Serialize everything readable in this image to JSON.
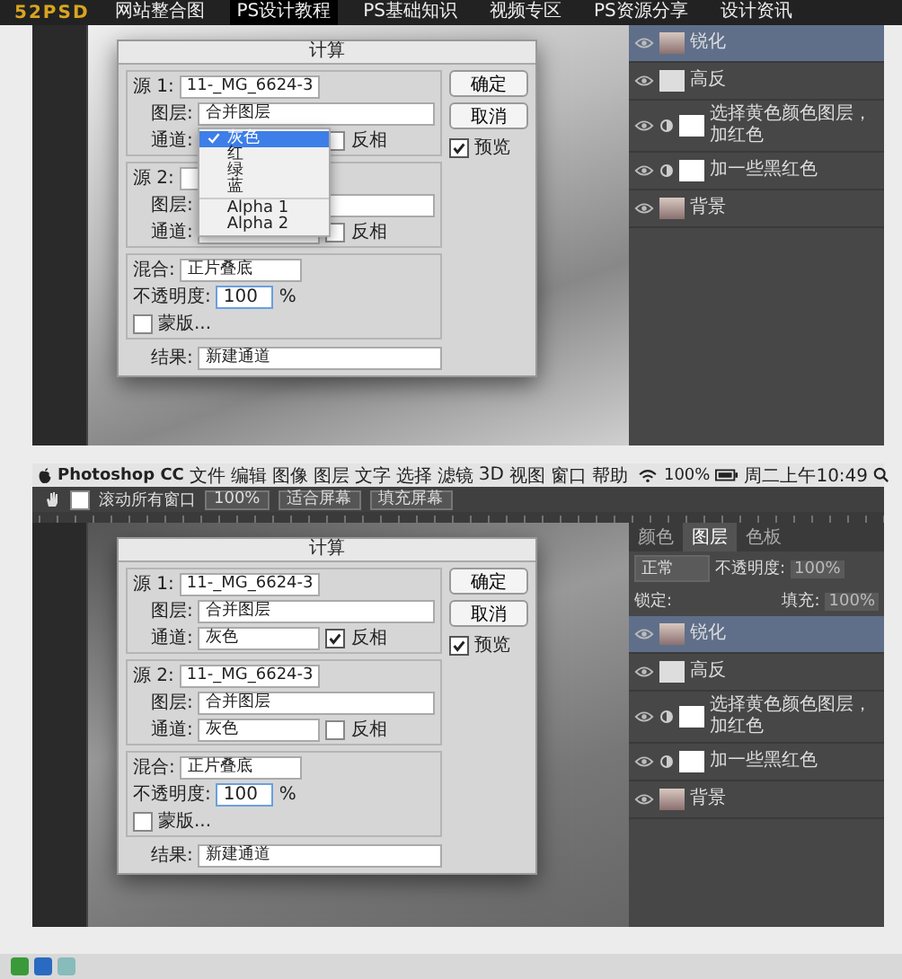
{
  "site_nav": {
    "logo": "52PSD",
    "items": [
      {
        "label": "网站整合图",
        "selected": false
      },
      {
        "label": "PS设计教程",
        "selected": true
      },
      {
        "label": "PS基础知识",
        "selected": false
      },
      {
        "label": "视频专区",
        "selected": false
      },
      {
        "label": "PS资源分享",
        "selected": false
      },
      {
        "label": "设计资讯",
        "selected": false
      }
    ]
  },
  "screenshot_1": {
    "dialog": {
      "title": "计算",
      "ok": "确定",
      "cancel": "取消",
      "preview": {
        "label": "预览",
        "checked": true
      },
      "source_1": {
        "label": "源 1:",
        "value": "11-_MG_6624-3",
        "layer_label": "图层:",
        "layer": "合并图层",
        "channel_label": "通道:",
        "invert_label": "反相",
        "invert": false
      },
      "source_2": {
        "label": "源 2:",
        "layer_label": "图层:",
        "channel_label": "通道:",
        "invert_label": "反相",
        "invert": false
      },
      "blend_label": "混合:",
      "blend": "正片叠底",
      "opacity_label": "不透明度:",
      "opacity": "100",
      "opacity_unit": "%",
      "mask": {
        "label": "蒙版...",
        "checked": false
      },
      "result_label": "结果:",
      "result": "新建通道",
      "channel_menu": [
        {
          "kind": "item",
          "label": "灰色",
          "selected": true
        },
        {
          "kind": "item",
          "label": "红",
          "selected": false
        },
        {
          "kind": "item",
          "label": "绿",
          "selected": false
        },
        {
          "kind": "item",
          "label": "蓝",
          "selected": false
        },
        {
          "kind": "separator"
        },
        {
          "kind": "item",
          "label": "Alpha 1",
          "selected": false
        },
        {
          "kind": "item",
          "label": "Alpha 2",
          "selected": false
        }
      ]
    },
    "layers": [
      {
        "name": "锐化",
        "kind": "image",
        "selected": true
      },
      {
        "name": "高反",
        "kind": "blank",
        "selected": false
      },
      {
        "name": "选择黄色颜色图层，加红色",
        "kind": "adjustment",
        "selected": false
      },
      {
        "name": "加一些黑红色",
        "kind": "adjustment",
        "selected": false
      },
      {
        "name": "背景",
        "kind": "image",
        "selected": false
      }
    ]
  },
  "screenshot_2": {
    "menu_bar": {
      "app": "Photoshop CC",
      "items": [
        "文件",
        "编辑",
        "图像",
        "图层",
        "文字",
        "选择",
        "滤镜",
        "3D",
        "视图",
        "窗口",
        "帮助"
      ],
      "battery": "100%",
      "clock": "周二上午10:49"
    },
    "options_bar": {
      "scroll_all": {
        "label": "滚动所有窗口",
        "checked": false
      },
      "buttons": [
        "100%",
        "适合屏幕",
        "填充屏幕"
      ]
    },
    "layers_panel": {
      "tabs": [
        {
          "label": "颜色",
          "selected": false
        },
        {
          "label": "图层",
          "selected": true
        },
        {
          "label": "色板",
          "selected": false
        }
      ],
      "blend_mode": "正常",
      "opacity_label": "不透明度:",
      "opacity": "100%",
      "lock_label": "锁定:",
      "fill_label": "填充:",
      "fill": "100%"
    },
    "layers": [
      {
        "name": "锐化",
        "kind": "image",
        "selected": true
      },
      {
        "name": "高反",
        "kind": "blank",
        "selected": false
      },
      {
        "name": "选择黄色颜色图层，加红色",
        "kind": "adjustment",
        "selected": false
      },
      {
        "name": "加一些黑红色",
        "kind": "adjustment",
        "selected": false
      },
      {
        "name": "背景",
        "kind": "image",
        "selected": false
      }
    ],
    "dialog": {
      "title": "计算",
      "ok": "确定",
      "cancel": "取消",
      "preview": {
        "label": "预览",
        "checked": true
      },
      "source_1": {
        "label": "源 1:",
        "value": "11-_MG_6624-3",
        "layer_label": "图层:",
        "layer": "合并图层",
        "channel_label": "通道:",
        "channel": "灰色",
        "invert_label": "反相",
        "invert": true
      },
      "source_2": {
        "label": "源 2:",
        "value": "11-_MG_6624-3",
        "layer_label": "图层:",
        "layer": "合并图层",
        "channel_label": "通道:",
        "channel": "灰色",
        "invert_label": "反相",
        "invert": false
      },
      "blend_label": "混合:",
      "blend": "正片叠底",
      "opacity_label": "不透明度:",
      "opacity": "100",
      "opacity_unit": "%",
      "mask": {
        "label": "蒙版...",
        "checked": false
      },
      "result_label": "结果:",
      "result": "新建通道"
    }
  }
}
